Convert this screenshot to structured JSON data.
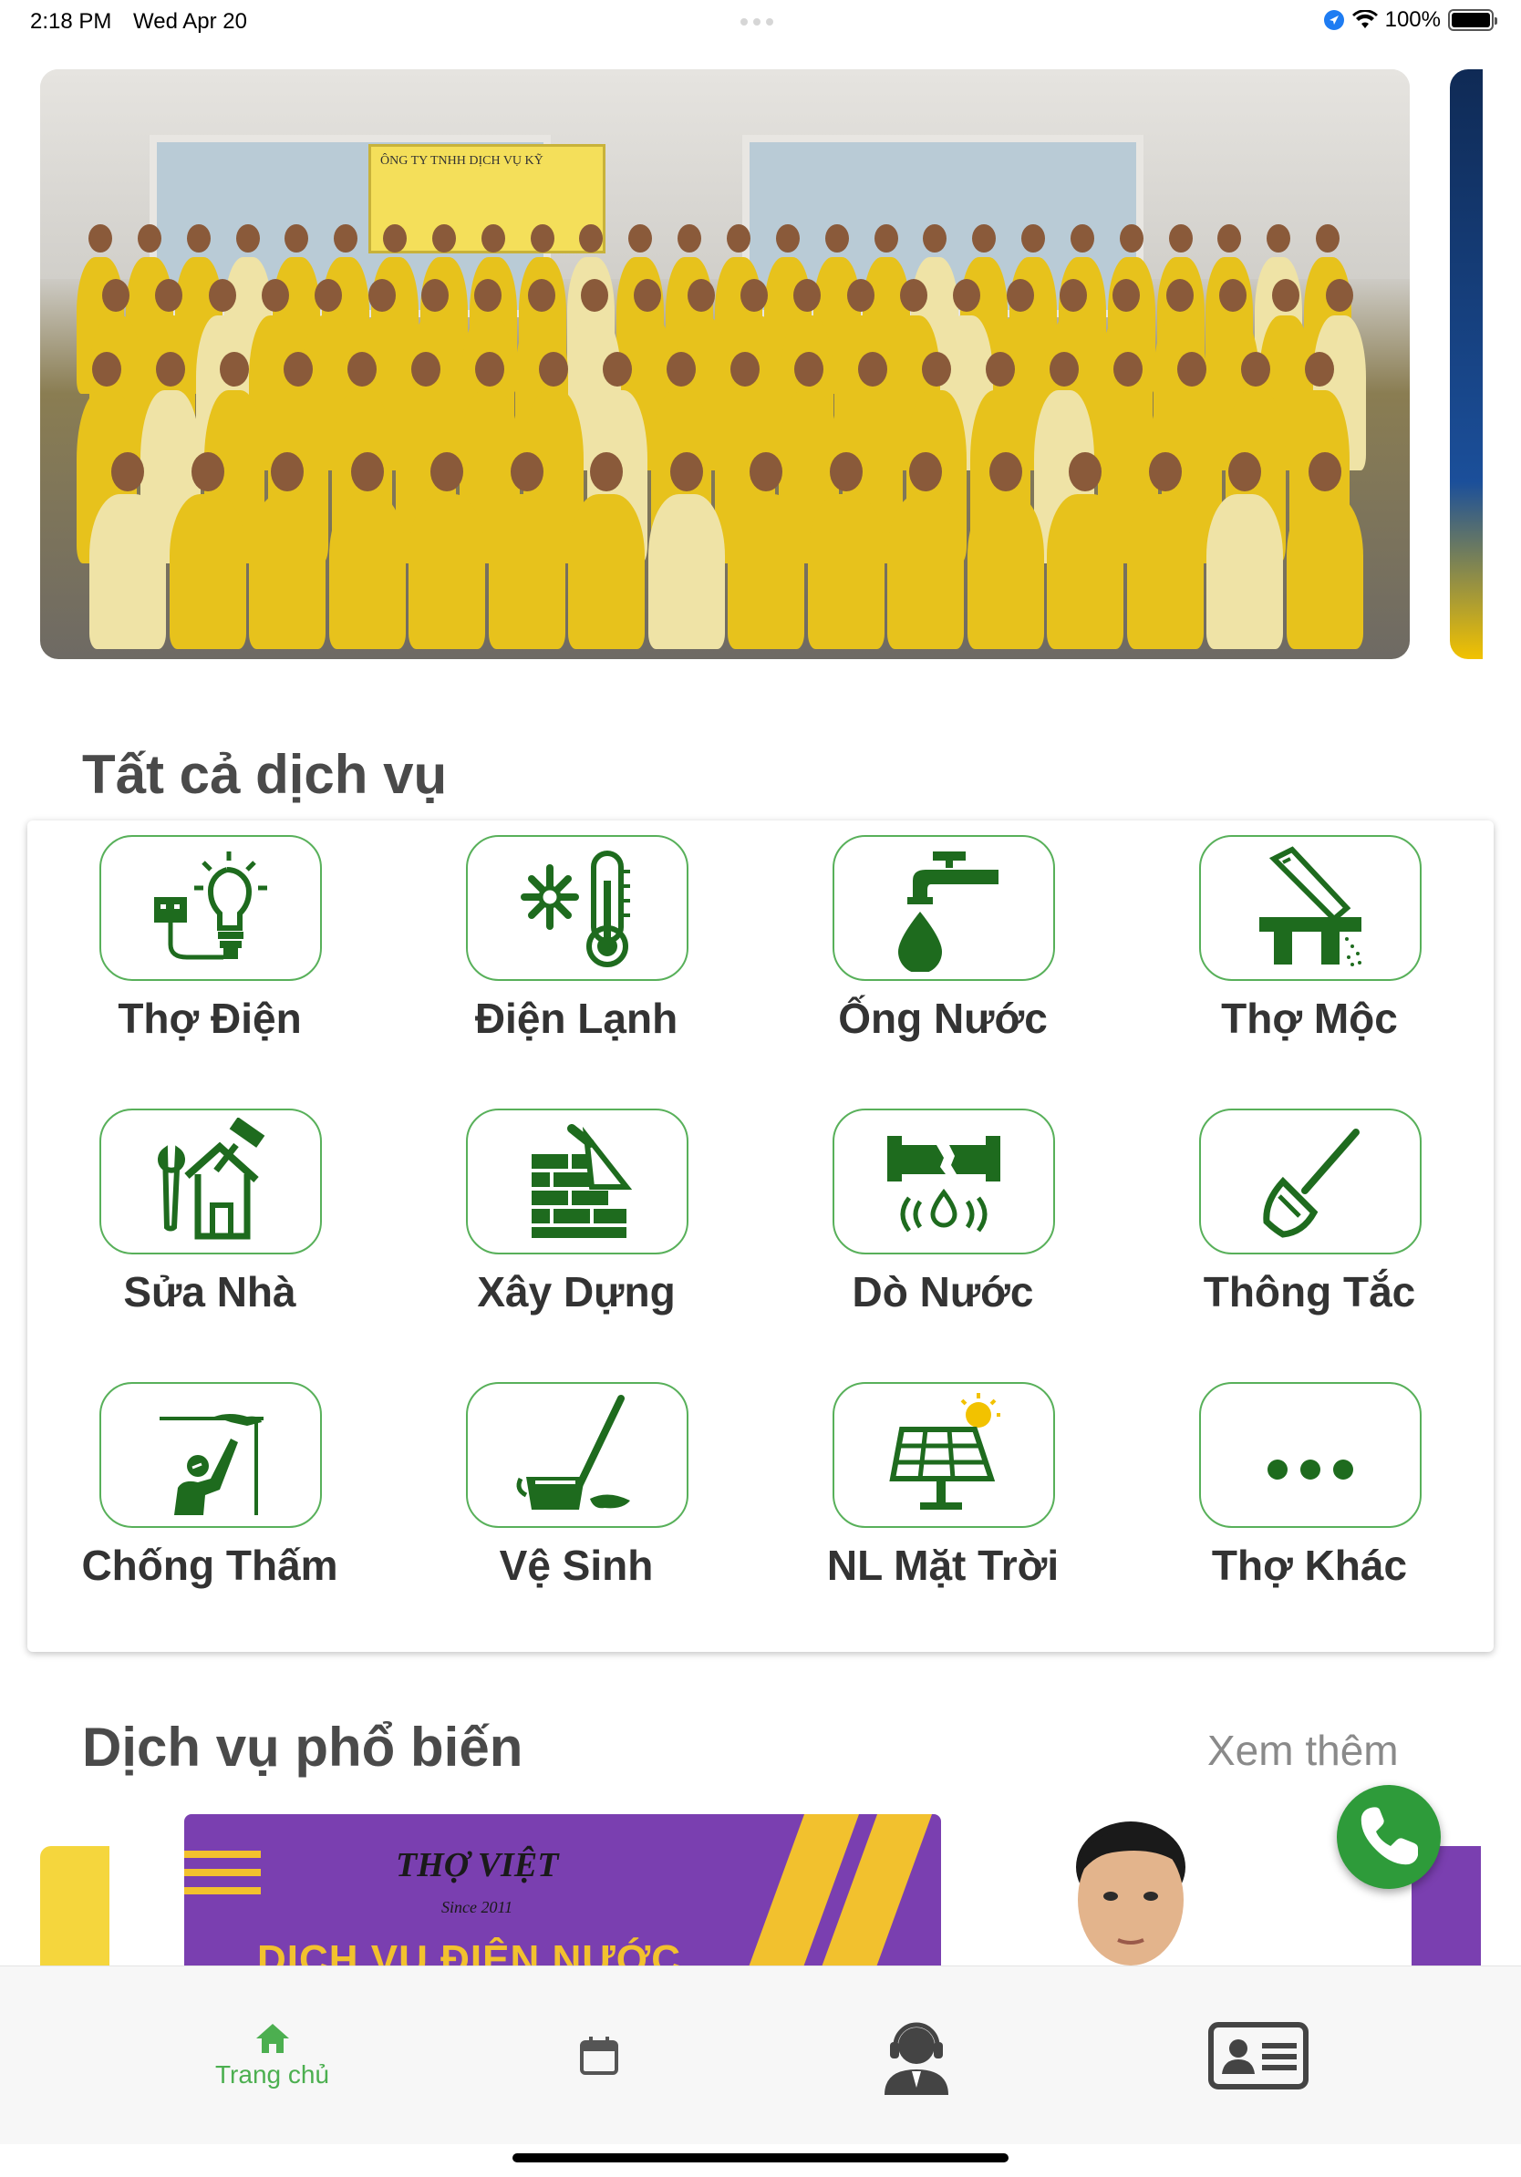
{
  "status_bar": {
    "time": "2:18 PM",
    "date": "Wed Apr 20",
    "battery": "100%"
  },
  "banner": {
    "sign_text": "ÔNG TY TNHH DỊCH VỤ KỸ"
  },
  "services": {
    "title": "Tất cả dịch vụ",
    "items": [
      {
        "label": "Thợ Điện",
        "icon": "electric-plug-bulb-icon"
      },
      {
        "label": "Điện Lạnh",
        "icon": "snowflake-thermometer-icon"
      },
      {
        "label": "Ống Nước",
        "icon": "faucet-drop-icon"
      },
      {
        "label": "Thợ Mộc",
        "icon": "saw-icon"
      },
      {
        "label": "Sửa Nhà",
        "icon": "house-tools-icon"
      },
      {
        "label": "Xây Dựng",
        "icon": "bricks-trowel-icon"
      },
      {
        "label": "Dò Nước",
        "icon": "pipe-leak-icon"
      },
      {
        "label": "Thông Tắc",
        "icon": "plunger-icon"
      },
      {
        "label": "Chống Thấm",
        "icon": "waterproof-wall-icon"
      },
      {
        "label": "Vệ Sinh",
        "icon": "mop-bucket-icon"
      },
      {
        "label": "NL Mặt Trời",
        "icon": "solar-panel-icon"
      },
      {
        "label": "Thợ Khác",
        "icon": "more-dots-icon"
      }
    ]
  },
  "popular": {
    "title": "Dịch vụ phổ biến",
    "see_more": "Xem thêm",
    "promo_logo": "THỢ VIỆT",
    "promo_since": "Since 2011",
    "promo_title": "DỊCH VỤ ĐIỆN NƯỚC"
  },
  "tab_bar": {
    "home_label": "Trang chủ",
    "active_color": "#4caf50",
    "inactive_color": "#555555"
  },
  "colors": {
    "accent_green": "#1e6b1e",
    "tile_border": "#58b05a",
    "call_button": "#2e9b3a"
  }
}
